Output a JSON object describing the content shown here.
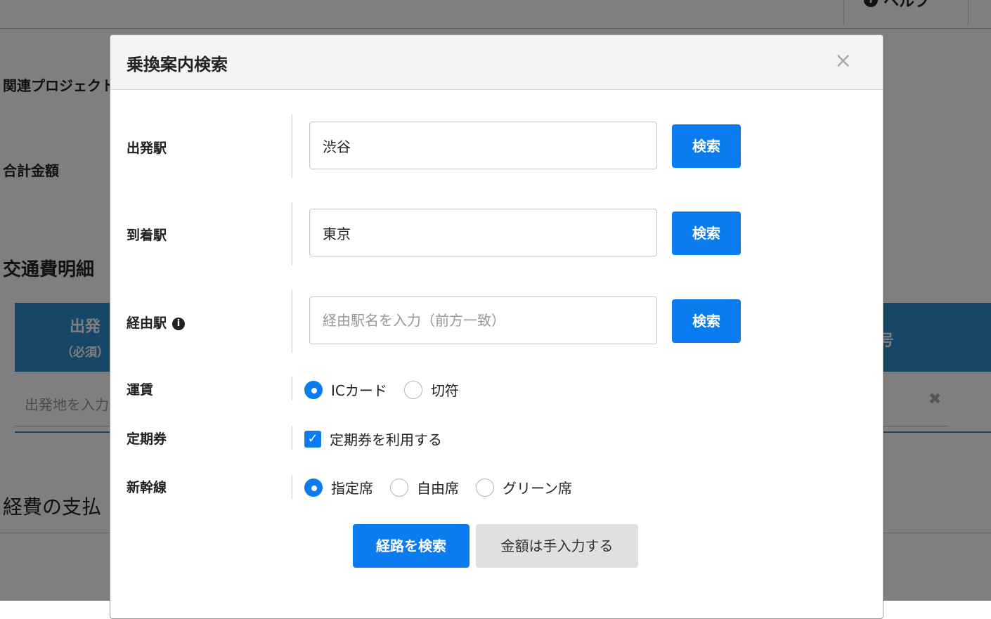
{
  "background": {
    "help_label": "ヘルプ",
    "related_project_label": "関連プロジェクト",
    "total_amount_label": "合計金額",
    "transport_detail_title": "交通費明細",
    "table_header_departure": "出発",
    "table_header_required": "（必須）",
    "table_header_right_partial": "号",
    "departure_placeholder": "出発地を入力",
    "expense_payment_title": "経費の支払"
  },
  "modal": {
    "title": "乗換案内検索",
    "close_glyph": "×",
    "departure_label": "出発駅",
    "departure_value": "渋谷",
    "arrival_label": "到着駅",
    "arrival_value": "東京",
    "via_label": "経由駅",
    "via_placeholder": "経由駅名を入力（前方一致）",
    "search_button": "検索",
    "fare": {
      "label": "運賃",
      "options": [
        "ICカード",
        "切符"
      ],
      "selected": "ICカード"
    },
    "commuter": {
      "label": "定期券",
      "checkbox_label": "定期券を利用する",
      "checked": true
    },
    "shinkansen": {
      "label": "新幹線",
      "options": [
        "指定席",
        "自由席",
        "グリーン席"
      ],
      "selected": "指定席"
    },
    "route_search_button": "経路を検索",
    "manual_amount_button": "金額は手入力する"
  }
}
